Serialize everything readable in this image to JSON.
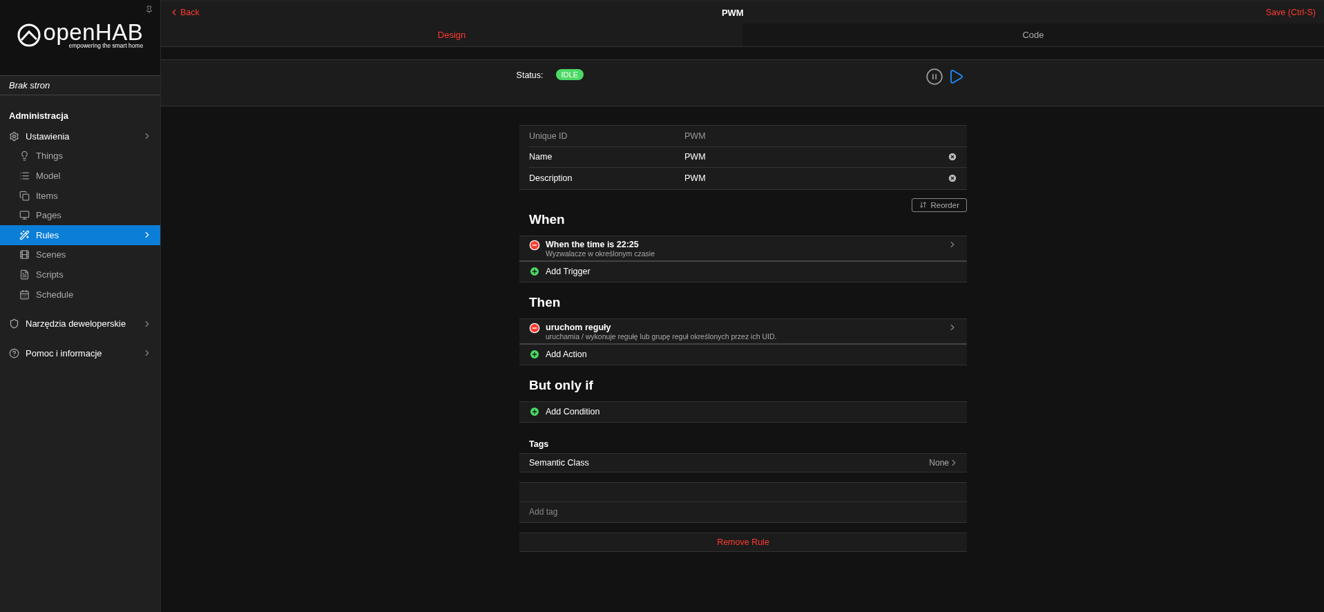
{
  "sidebar": {
    "logo": {
      "name": "openHAB",
      "tagline": "empowering the smart home"
    },
    "pages_note": "Brak stron",
    "section": "Administracja",
    "items": [
      {
        "label": "Ustawienia",
        "selected": false,
        "children": [
          {
            "label": "Things",
            "selected": false
          },
          {
            "label": "Model",
            "selected": false
          },
          {
            "label": "Items",
            "selected": false
          },
          {
            "label": "Pages",
            "selected": false
          },
          {
            "label": "Rules",
            "selected": true
          },
          {
            "label": "Scenes",
            "selected": false
          },
          {
            "label": "Scripts",
            "selected": false
          },
          {
            "label": "Schedule",
            "selected": false
          }
        ]
      },
      {
        "label": "Narzędzia deweloperskie",
        "selected": false
      },
      {
        "label": "Pomoc i informacje",
        "selected": false
      }
    ]
  },
  "navbar": {
    "back": "Back",
    "title": "PWM",
    "save": "Save (Ctrl-S)"
  },
  "tabs": [
    {
      "label": "Design",
      "selected": true
    },
    {
      "label": "Code",
      "selected": false
    }
  ],
  "status": {
    "label": "Status:",
    "badge": "IDLE"
  },
  "fields": [
    {
      "label": "Unique ID",
      "value": "PWM",
      "disabled": true
    },
    {
      "label": "Name",
      "value": "PWM",
      "disabled": false
    },
    {
      "label": "Description",
      "value": "PWM",
      "disabled": false
    }
  ],
  "reorder": "Reorder",
  "sections": [
    {
      "title": "When",
      "items": [
        {
          "title": "When the time is 22:25",
          "subtitle": "Wyzwalacze w określonym czasie"
        }
      ],
      "add": "Add Trigger"
    },
    {
      "title": "Then",
      "items": [
        {
          "title": "uruchom reguły",
          "subtitle": "uruchamia / wykonuje regułę lub grupę reguł określonych przez ich UID."
        }
      ],
      "add": "Add Action"
    },
    {
      "title": "But only if",
      "add": "Add Condition"
    }
  ],
  "tags": {
    "heading": "Tags",
    "semantic_label": "Semantic Class",
    "semantic_value": "None",
    "placeholder": "Add tag"
  },
  "remove": "Remove Rule"
}
